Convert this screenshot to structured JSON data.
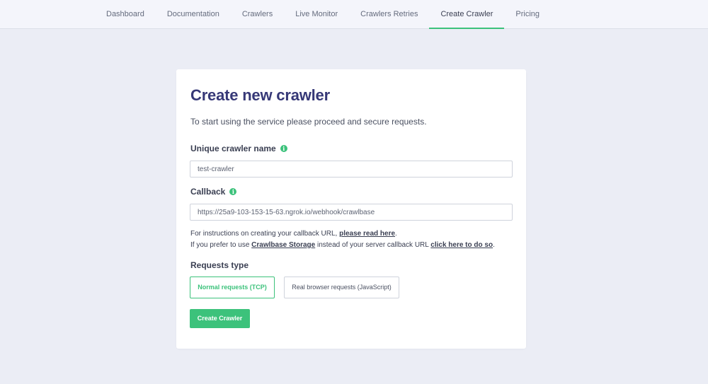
{
  "nav": {
    "items": [
      "Dashboard",
      "Documentation",
      "Crawlers",
      "Live Monitor",
      "Crawlers Retries",
      "Create Crawler",
      "Pricing"
    ],
    "active": "Create Crawler"
  },
  "card": {
    "title": "Create new crawler",
    "subtitle": "To start using the service please proceed and secure requests."
  },
  "form": {
    "name_label": "Unique crawler name",
    "name_value": "test-crawler",
    "callback_label": "Callback",
    "callback_value": "https://25a9-103-153-15-63.ngrok.io/webhook/crawlbase",
    "help1_prefix": "For instructions on creating your callback URL, ",
    "help1_link": "please read here",
    "help1_suffix": ".",
    "help2_prefix": "If you prefer to use ",
    "help2_link1": "Crawlbase Storage",
    "help2_middle": " instead of your server callback URL ",
    "help2_link2": "click here to do so",
    "help2_suffix": ".",
    "requests_label": "Requests type",
    "request_options": [
      "Normal requests (TCP)",
      "Real browser requests (JavaScript)"
    ],
    "request_selected": "Normal requests (TCP)",
    "submit_label": "Create Crawler"
  },
  "colors": {
    "accent": "#3cc27b",
    "title": "#363877",
    "background": "#ebedf5"
  },
  "icons": {
    "info": "info-circle-icon"
  }
}
